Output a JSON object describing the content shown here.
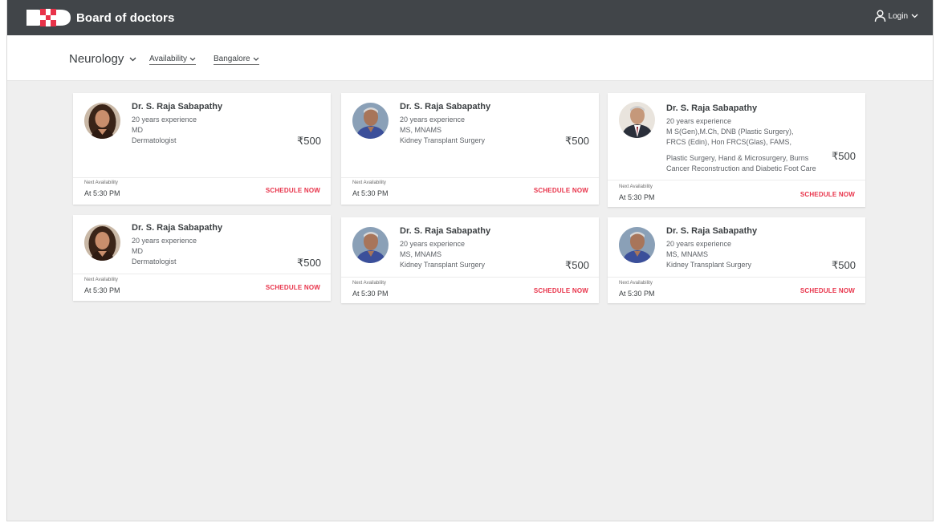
{
  "brand": {
    "title": "Board of doctors",
    "logo_text": "B+D"
  },
  "header": {
    "login_label": "Login"
  },
  "filters": {
    "specialty": "Neurology",
    "availability": "Availability",
    "city": "Bangalore"
  },
  "colors": {
    "topbar": "#414549",
    "accent": "#e8334a",
    "background": "#efefef"
  },
  "doctors": [
    {
      "name": "Dr. S. Raja Sabapathy",
      "experience": "20 years experience",
      "lines": [
        "MD",
        "Dermatologist"
      ],
      "fee": "₹500",
      "availability_label": "Next Availability",
      "availability_time": "At 5:30 PM",
      "action": "SCHEDULE NOW",
      "photo": "female-doctor"
    },
    {
      "name": "Dr. S. Raja Sabapathy",
      "experience": "20 years experience",
      "lines": [
        "MS, MNAMS",
        "Kidney Transplant Surgery"
      ],
      "fee": "₹500",
      "availability_label": "Next Availability",
      "availability_time": "At 5:30 PM",
      "action": "SCHEDULE NOW",
      "photo": "male-doctor-blue"
    },
    {
      "name": "Dr. S. Raja Sabapathy",
      "experience": "20 years experience",
      "lines": [
        "M S(Gen),M.Ch, DNB (Plastic Surgery),",
        "FRCS (Edin), Hon FRCS(Glas), FAMS,",
        "Plastic Surgery, Hand & Microsurgery, Burns",
        "Cancer Reconstruction and Diabetic Foot Care"
      ],
      "fee": "₹500",
      "availability_label": "Next Availability",
      "availability_time": "At 5:30 PM",
      "action": "SCHEDULE NOW",
      "photo": "male-doctor-suit"
    },
    {
      "name": "Dr. S. Raja Sabapathy",
      "experience": "20 years experience",
      "lines": [
        "MD",
        "Dermatologist"
      ],
      "fee": "₹500",
      "availability_label": "Next Availability",
      "availability_time": "At 5:30 PM",
      "action": "SCHEDULE NOW",
      "photo": "female-doctor"
    },
    {
      "name": "Dr. S. Raja Sabapathy",
      "experience": "20 years experience",
      "lines": [
        "MS, MNAMS",
        "Kidney Transplant Surgery"
      ],
      "fee": "₹500",
      "availability_label": "Next Availability",
      "availability_time": "At 5:30 PM",
      "action": "SCHEDULE NOW",
      "photo": "male-doctor-blue"
    },
    {
      "name": "Dr. S. Raja Sabapathy",
      "experience": "20 years experience",
      "lines": [
        "MS, MNAMS",
        "Kidney Transplant Surgery"
      ],
      "fee": "₹500",
      "availability_label": "Next Availability",
      "availability_time": "At 5:30 PM",
      "action": "SCHEDULE NOW",
      "photo": "male-doctor-blue"
    }
  ]
}
